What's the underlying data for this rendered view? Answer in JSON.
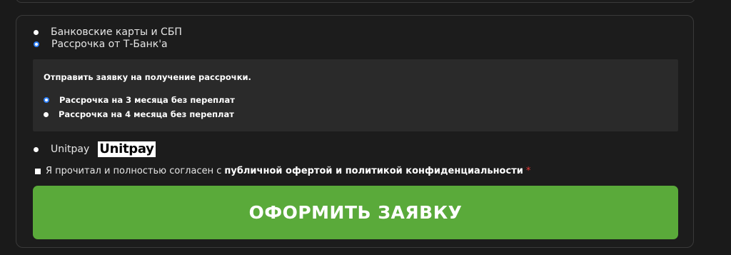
{
  "payment_methods": {
    "cards_label": "Банковские карты и СБП",
    "tbank_label": "Рассрочка от Т-Банк'а",
    "unitpay_label": "Unitpay",
    "unitpay_logo_text": "Unitpay"
  },
  "installment": {
    "title": "Отправить заявку на получение рассрочки.",
    "options": [
      {
        "label": "Рассрочка на 3 месяца без переплат",
        "selected": true
      },
      {
        "label": "Рассрочка на 4 месяца без переплат",
        "selected": false
      }
    ]
  },
  "agreement": {
    "text": "Я прочитал и полностью согласен с",
    "link_text": "публичной офертой и политикой конфиденциальности",
    "required_mark": "*"
  },
  "submit": {
    "label": "ОФОРМИТЬ ЗАЯВКУ"
  },
  "colors": {
    "accent_green": "#5aaa3a",
    "radio_selected": "#2d7ff9",
    "required_red": "#e53935"
  }
}
